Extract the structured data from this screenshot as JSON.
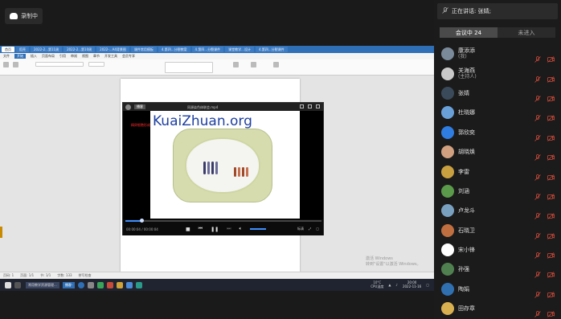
{
  "recording": {
    "label": "录制中"
  },
  "shared": {
    "wps_tabs": [
      "首页",
      "稻壳",
      "2022-2...第11周",
      "2022-2...第10周",
      "2022-...A4背景图",
      "课件常用模板",
      "4.第四...分裂教案",
      "4.第四...分裂课件",
      "课堂教学...设计",
      "4.第四...分裂课件"
    ],
    "menus": [
      "文件",
      "开始",
      "插入",
      "页面布局",
      "引用",
      "审阅",
      "视图",
      "章节",
      "开发工具",
      "会员专享"
    ],
    "active_menu": "开始",
    "player": {
      "badge": "播客",
      "title": "同源染色体联会.mp4",
      "watermark": "KuaiZhuan.org",
      "red_label": "精卵细胞形成",
      "time": "00:00:04 / 00:00:04",
      "right_controls": [
        "标清",
        "⤢",
        "▢"
      ],
      "progress": 0.08
    },
    "status": [
      "页码: 1",
      "页面: 1/1",
      "节: 1/1",
      "字数: 133",
      "拼写检查"
    ],
    "watermark_windows": [
      "激活 Windows",
      "转到\"设置\"以激活 Windows。"
    ],
    "taskbar": {
      "app1": "常用教学资源管理...",
      "app2": "播客-",
      "temp": "10°C",
      "cpu": "CPU温度",
      "time": "20:00",
      "date": "2022-11-16"
    }
  },
  "panel": {
    "speaking": "正在讲话: 张婧;",
    "tabs": [
      {
        "label": "会议中 24"
      },
      {
        "label": "未进入"
      }
    ],
    "participants": [
      {
        "name": "康添添",
        "role": "(我)",
        "avatar": "#7a8a9a"
      },
      {
        "name": "关海燕",
        "role": "(主持人)",
        "avatar": "#c9c9c9"
      },
      {
        "name": "张婧",
        "role": "",
        "avatar": "#3a4a5a"
      },
      {
        "name": "杜晓娜",
        "role": "",
        "avatar": "#6aa0d8"
      },
      {
        "name": "郭欣奕",
        "role": "",
        "avatar": "#2f7de0"
      },
      {
        "name": "胡晓焕",
        "role": "",
        "avatar": "#d0a080"
      },
      {
        "name": "李雷",
        "role": "",
        "avatar": "#c8a040"
      },
      {
        "name": "刘涵",
        "role": "",
        "avatar": "#5a9a4a"
      },
      {
        "name": "卢龙斗",
        "role": "",
        "avatar": "#7aa0c0"
      },
      {
        "name": "石晓卫",
        "role": "",
        "avatar": "#c07040"
      },
      {
        "name": "宋小锋",
        "role": "",
        "avatar": "#ffffff"
      },
      {
        "name": "孙强",
        "role": "",
        "avatar": "#508050"
      },
      {
        "name": "陶娟",
        "role": "",
        "avatar": "#3070b0"
      },
      {
        "name": "田存章",
        "role": "",
        "avatar": "#d8b050"
      }
    ]
  }
}
